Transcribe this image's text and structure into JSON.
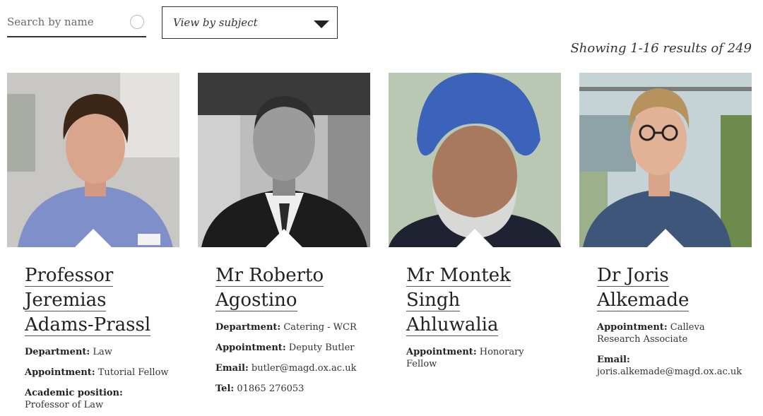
{
  "search": {
    "placeholder": "Search by name"
  },
  "filter": {
    "selected": "View by subject"
  },
  "results_text": "Showing 1-16 results of 249",
  "people": [
    {
      "name": "Professor Jeremias Adams-Prassl",
      "fields": [
        {
          "label": "Department:",
          "value": "Law"
        },
        {
          "label": "Appointment:",
          "value": "Tutorial Fellow"
        },
        {
          "label": "Academic position:",
          "value": "Professor of Law"
        }
      ]
    },
    {
      "name": "Mr Roberto Agostino",
      "fields": [
        {
          "label": "Department:",
          "value": "Catering - WCR"
        },
        {
          "label": "Appointment:",
          "value": "Deputy Butler"
        },
        {
          "label": "Email:",
          "value": "butler@magd.ox.ac.uk"
        },
        {
          "label": "Tel:",
          "value": "01865 276053"
        }
      ]
    },
    {
      "name": "Mr Montek Singh Ahluwalia",
      "fields": [
        {
          "label": "Appointment:",
          "value": "Honorary Fellow"
        }
      ]
    },
    {
      "name": "Dr Joris Alkemade",
      "fields": [
        {
          "label": "Appointment:",
          "value": "Calleva Research Associate"
        },
        {
          "label": "Email:",
          "value": "joris.alkemade@magd.ox.ac.uk"
        }
      ]
    }
  ]
}
